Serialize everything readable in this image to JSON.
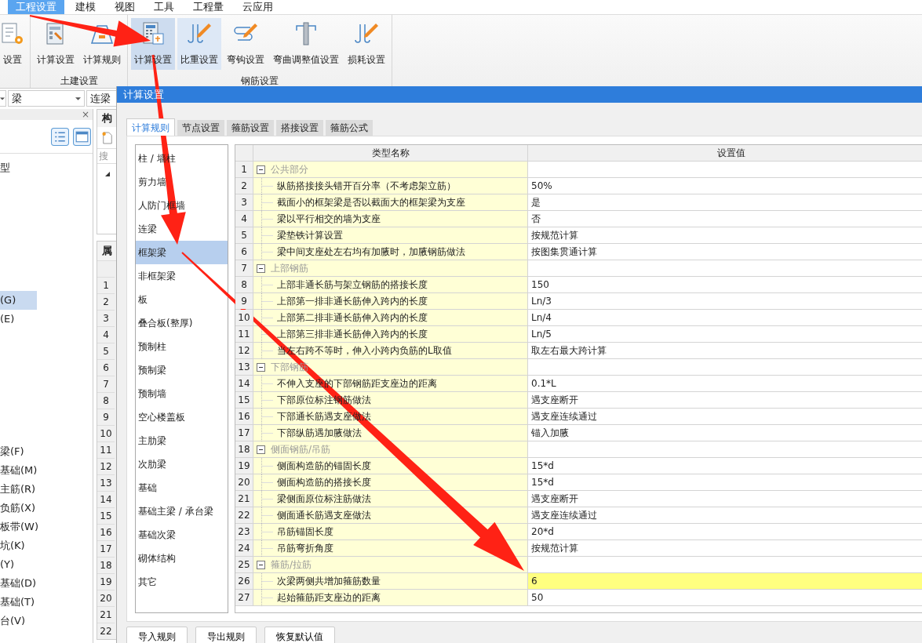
{
  "menu": [
    {
      "label": "工程设置",
      "selected": true
    },
    {
      "label": "建模",
      "selected": false
    },
    {
      "label": "视图",
      "selected": false
    },
    {
      "label": "工具",
      "selected": false
    },
    {
      "label": "工程量",
      "selected": false
    },
    {
      "label": "云应用",
      "selected": false
    }
  ],
  "ribbon": {
    "groups": [
      {
        "buttons": [
          {
            "label": "设置",
            "kind": "gear-doc",
            "selected": false,
            "hovered": false
          }
        ]
      },
      {
        "label": "土建设置",
        "buttons": [
          {
            "label": "计算设置",
            "kind": "wrench-doc",
            "selected": false,
            "hovered": false
          },
          {
            "label": "计算规则",
            "kind": "rule",
            "selected": false,
            "hovered": false
          }
        ]
      },
      {
        "label": "钢筋设置",
        "buttons": [
          {
            "label": "计算设置",
            "kind": "calc",
            "selected": true,
            "hovered": false
          },
          {
            "label": "比重设置",
            "kind": "hooks",
            "selected": false,
            "hovered": true
          },
          {
            "label": "弯钩设置",
            "kind": "hook",
            "selected": false,
            "hovered": false
          },
          {
            "label": "弯曲调整值设置",
            "kind": "column",
            "selected": false,
            "hovered": false
          },
          {
            "label": "损耗设置",
            "kind": "hooks",
            "selected": false,
            "hovered": false
          }
        ]
      }
    ]
  },
  "filter_bar": {
    "combos": [
      {
        "caret": true
      },
      {
        "text": "梁",
        "caret": true
      },
      {
        "text": "连梁",
        "caret": false
      }
    ]
  },
  "left_panel": {
    "close": "×",
    "groups": [
      {
        "items": [
          {
            "label": "型",
            "selected": false
          }
        ]
      },
      {
        "items": [
          {
            "label": "(G)",
            "selected": true
          },
          {
            "label": "(E)",
            "selected": false
          }
        ]
      },
      {
        "items": [
          {
            "label": "梁(F)",
            "selected": false
          },
          {
            "label": "基础(M)",
            "selected": false
          },
          {
            "label": "主筋(R)",
            "selected": false
          },
          {
            "label": "负筋(X)",
            "selected": false
          },
          {
            "label": "板带(W)",
            "selected": false
          },
          {
            "label": "坑(K)",
            "selected": false
          },
          {
            "label": "(Y)",
            "selected": false
          },
          {
            "label": "基础(D)",
            "selected": false
          },
          {
            "label": "基础(T)",
            "selected": false
          },
          {
            "label": "台(V)",
            "selected": false
          }
        ]
      }
    ]
  },
  "component_panel": {
    "title": "构",
    "search_placeholder": "搜"
  },
  "property_panel": {
    "title": "属",
    "row_numbers": [
      "1",
      "2",
      "3",
      "4",
      "5",
      "6",
      "7",
      "8",
      "9",
      "10",
      "11",
      "12",
      "13",
      "14",
      "15",
      "16",
      "17",
      "18",
      "19",
      "20",
      "21",
      "22"
    ]
  },
  "dialog": {
    "title": "计算设置",
    "tabs": [
      {
        "label": "计算规则",
        "selected": true
      },
      {
        "label": "节点设置",
        "selected": false
      },
      {
        "label": "箍筋设置",
        "selected": false
      },
      {
        "label": "搭接设置",
        "selected": false
      },
      {
        "label": "箍筋公式",
        "selected": false
      }
    ],
    "categories": [
      {
        "label": "柱 / 墙柱",
        "selected": false
      },
      {
        "label": "剪力墙",
        "selected": false
      },
      {
        "label": "人防门框墙",
        "selected": false
      },
      {
        "label": "连梁",
        "selected": false
      },
      {
        "label": "框架梁",
        "selected": true
      },
      {
        "label": "非框架梁",
        "selected": false
      },
      {
        "label": "板",
        "selected": false
      },
      {
        "label": "叠合板(整厚)",
        "selected": false
      },
      {
        "label": "预制柱",
        "selected": false
      },
      {
        "label": "预制梁",
        "selected": false
      },
      {
        "label": "预制墙",
        "selected": false
      },
      {
        "label": "空心楼盖板",
        "selected": false
      },
      {
        "label": "主肋梁",
        "selected": false
      },
      {
        "label": "次肋梁",
        "selected": false
      },
      {
        "label": "基础",
        "selected": false
      },
      {
        "label": "基础主梁 / 承台梁",
        "selected": false
      },
      {
        "label": "基础次梁",
        "selected": false
      },
      {
        "label": "砌体结构",
        "selected": false
      },
      {
        "label": "其它",
        "selected": false
      }
    ],
    "table": {
      "columns": [
        "类型名称",
        "设置值"
      ],
      "rows": [
        {
          "num": "1",
          "kind": "group",
          "expanded": true,
          "name": "公共部分"
        },
        {
          "num": "2",
          "kind": "item",
          "name": "纵筋搭接接头错开百分率（不考虑架立筋）",
          "value": "50%",
          "highlighted": false
        },
        {
          "num": "3",
          "kind": "item",
          "name": "截面小的框架梁是否以截面大的框架梁为支座",
          "value": "是",
          "highlighted": false
        },
        {
          "num": "4",
          "kind": "item",
          "name": "梁以平行相交的墙为支座",
          "value": "否",
          "highlighted": false
        },
        {
          "num": "5",
          "kind": "item",
          "name": "梁垫铁计算设置",
          "value": "按规范计算",
          "highlighted": false
        },
        {
          "num": "6",
          "kind": "item",
          "name": "梁中间支座处左右均有加腋时，加腋钢筋做法",
          "value": "按图集贯通计算",
          "highlighted": false
        },
        {
          "num": "7",
          "kind": "group",
          "expanded": true,
          "name": "上部钢筋"
        },
        {
          "num": "8",
          "kind": "item",
          "name": "上部非通长筋与架立钢筋的搭接长度",
          "value": "150",
          "highlighted": false
        },
        {
          "num": "9",
          "kind": "item",
          "name": "上部第一排非通长筋伸入跨内的长度",
          "value": "Ln/3",
          "highlighted": false
        },
        {
          "num": "10",
          "kind": "item",
          "name": "上部第二排非通长筋伸入跨内的长度",
          "value": "Ln/4",
          "highlighted": false
        },
        {
          "num": "11",
          "kind": "item",
          "name": "上部第三排非通长筋伸入跨内的长度",
          "value": "Ln/5",
          "highlighted": false
        },
        {
          "num": "12",
          "kind": "item",
          "name": "当左右跨不等时，伸入小跨内负筋的L取值",
          "value": "取左右最大跨计算",
          "highlighted": false
        },
        {
          "num": "13",
          "kind": "group",
          "expanded": true,
          "name": "下部钢筋"
        },
        {
          "num": "14",
          "kind": "item",
          "name": "不伸入支座的下部钢筋距支座边的距离",
          "value": "0.1*L",
          "highlighted": false
        },
        {
          "num": "15",
          "kind": "item",
          "name": "下部原位标注钢筋做法",
          "value": "遇支座断开",
          "highlighted": false
        },
        {
          "num": "16",
          "kind": "item",
          "name": "下部通长筋遇支座做法",
          "value": "遇支座连续通过",
          "highlighted": false
        },
        {
          "num": "17",
          "kind": "item",
          "name": "下部纵筋遇加腋做法",
          "value": "锚入加腋",
          "highlighted": false
        },
        {
          "num": "18",
          "kind": "group",
          "expanded": true,
          "name": "侧面钢筋/吊筋"
        },
        {
          "num": "19",
          "kind": "item",
          "name": "侧面构造筋的锚固长度",
          "value": "15*d",
          "highlighted": false
        },
        {
          "num": "20",
          "kind": "item",
          "name": "侧面构造筋的搭接长度",
          "value": "15*d",
          "highlighted": false
        },
        {
          "num": "21",
          "kind": "item",
          "name": "梁侧面原位标注筋做法",
          "value": "遇支座断开",
          "highlighted": false
        },
        {
          "num": "22",
          "kind": "item",
          "name": "侧面通长筋遇支座做法",
          "value": "遇支座连续通过",
          "highlighted": false
        },
        {
          "num": "23",
          "kind": "item",
          "name": "吊筋锚固长度",
          "value": "20*d",
          "highlighted": false
        },
        {
          "num": "24",
          "kind": "item",
          "name": "吊筋弯折角度",
          "value": "按规范计算",
          "highlighted": false
        },
        {
          "num": "25",
          "kind": "group",
          "expanded": true,
          "name": "箍筋/拉筋"
        },
        {
          "num": "26",
          "kind": "item",
          "name": "次梁两侧共增加箍筋数量",
          "value": "6",
          "highlighted": true
        },
        {
          "num": "27",
          "kind": "item",
          "name": "起始箍筋距支座边的距离",
          "value": "50",
          "highlighted": false
        }
      ]
    },
    "buttons": [
      "导入规则",
      "导出规则",
      "恢复默认值"
    ]
  }
}
